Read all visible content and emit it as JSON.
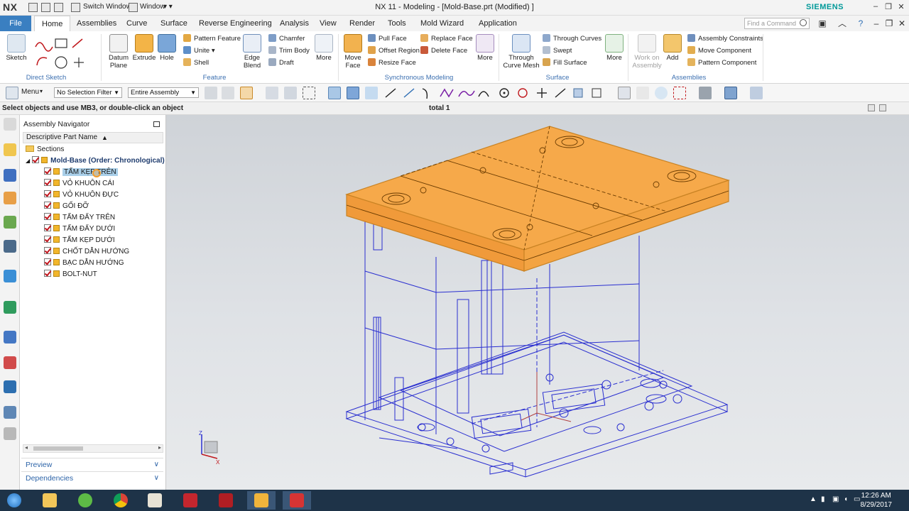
{
  "app": {
    "logo": "NX",
    "title": "NX 11 - Modeling - [Mold-Base.prt (Modified) ]",
    "brand": "SIEMENS",
    "switch_window": "Switch Window",
    "window_menu": "Window"
  },
  "tabs": [
    "File",
    "Home",
    "Assemblies",
    "Curve",
    "Surface",
    "Reverse Engineering",
    "Analysis",
    "View",
    "Render",
    "Tools",
    "Mold Wizard",
    "Application"
  ],
  "active_tab": "Home",
  "search": {
    "placeholder": "Find a Command"
  },
  "ribbon": {
    "direct_sketch": {
      "label": "Direct Sketch",
      "sketch": "Sketch"
    },
    "feature": {
      "label": "Feature",
      "datum_plane": "Datum Plane",
      "extrude": "Extrude",
      "hole": "Hole",
      "pattern_feature": "Pattern Feature",
      "unite": "Unite",
      "shell": "Shell",
      "edge_blend": "Edge Blend",
      "chamfer": "Chamfer",
      "trim_body": "Trim Body",
      "draft": "Draft",
      "more": "More"
    },
    "synchronous": {
      "label": "Synchronous Modeling",
      "move_face": "Move Face",
      "pull_face": "Pull Face",
      "offset_region": "Offset Region",
      "resize_face": "Resize Face",
      "replace_face": "Replace Face",
      "delete_face": "Delete Face",
      "more": "More"
    },
    "surface": {
      "label": "Surface",
      "through_curve_mesh": "Through Curve Mesh",
      "through_curves": "Through Curves",
      "swept": "Swept",
      "fill_surface": "Fill Surface",
      "more": "More"
    },
    "assemblies": {
      "label": "Assemblies",
      "work_on_assembly": "Work on Assembly",
      "add": "Add",
      "assembly_constraints": "Assembly Constraints",
      "move_component": "Move Component",
      "pattern_component": "Pattern Component"
    }
  },
  "toolbar": {
    "menu": "Menu",
    "selection_filter": "No Selection Filter",
    "scope": "Entire Assembly"
  },
  "status": {
    "prompt": "Select objects and use MB3, or double-click an object",
    "center": "total 1"
  },
  "navigator": {
    "title": "Assembly Navigator",
    "column": "Descriptive Part Name",
    "sections": "Sections",
    "root": "Mold-Base (Order: Chronological)",
    "components": [
      "TẤM KẸP TRÊN",
      "VỎ KHUÔN CÁI",
      "VỎ KHUÔN ĐỰC",
      "GỐI ĐỠ",
      "TẤM ĐẨY TRÊN",
      "TẤM ĐẨY DƯỚI",
      "TẤM KẸP DƯỚI",
      "CHỐT DẪN HƯỚNG",
      "BẠC DẪN HƯỚNG",
      "BOLT-NUT"
    ],
    "selected_index": 0,
    "panels": {
      "preview": "Preview",
      "dependencies": "Dependencies"
    }
  },
  "viewport": {
    "highlight_color": "#f5a94a",
    "wire_color": "#2a2fd0",
    "triad": {
      "x": "X",
      "z": "Z"
    }
  },
  "taskbar": {
    "time": "12:26 AM",
    "date": "8/29/2017"
  }
}
